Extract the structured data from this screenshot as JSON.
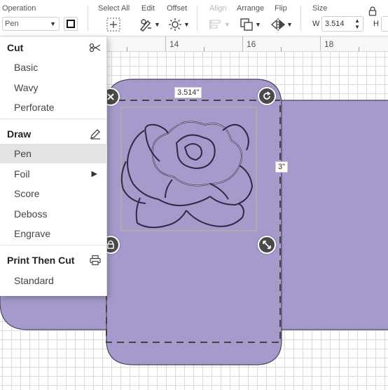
{
  "toolbar": {
    "operation": {
      "label": "Operation",
      "value": "Pen"
    },
    "select_all": {
      "label": "Select All"
    },
    "edit": {
      "label": "Edit"
    },
    "offset": {
      "label": "Offset"
    },
    "align": {
      "label": "Align"
    },
    "arrange": {
      "label": "Arrange"
    },
    "flip": {
      "label": "Flip"
    },
    "size": {
      "label": "Size",
      "w_label": "W",
      "w_value": "3.514",
      "h_label": "H"
    }
  },
  "ruler": {
    "marks": [
      "14",
      "16",
      "18"
    ]
  },
  "menu": {
    "sections": [
      {
        "title": "Cut",
        "icon": "scissors-icon",
        "items": [
          "Basic",
          "Wavy",
          "Perforate"
        ]
      },
      {
        "title": "Draw",
        "icon": "pencil-icon",
        "items": [
          "Pen",
          "Foil",
          "Score",
          "Deboss",
          "Engrave"
        ]
      },
      {
        "title": "Print Then Cut",
        "icon": "printer-icon",
        "items": [
          "Standard"
        ]
      }
    ],
    "selected": "Pen",
    "submenu_item": "Foil"
  },
  "canvas": {
    "width_label": "3.514\"",
    "height_label": "3\"",
    "shape_color": "#a59acb",
    "shape_stroke": "#4a4560"
  }
}
